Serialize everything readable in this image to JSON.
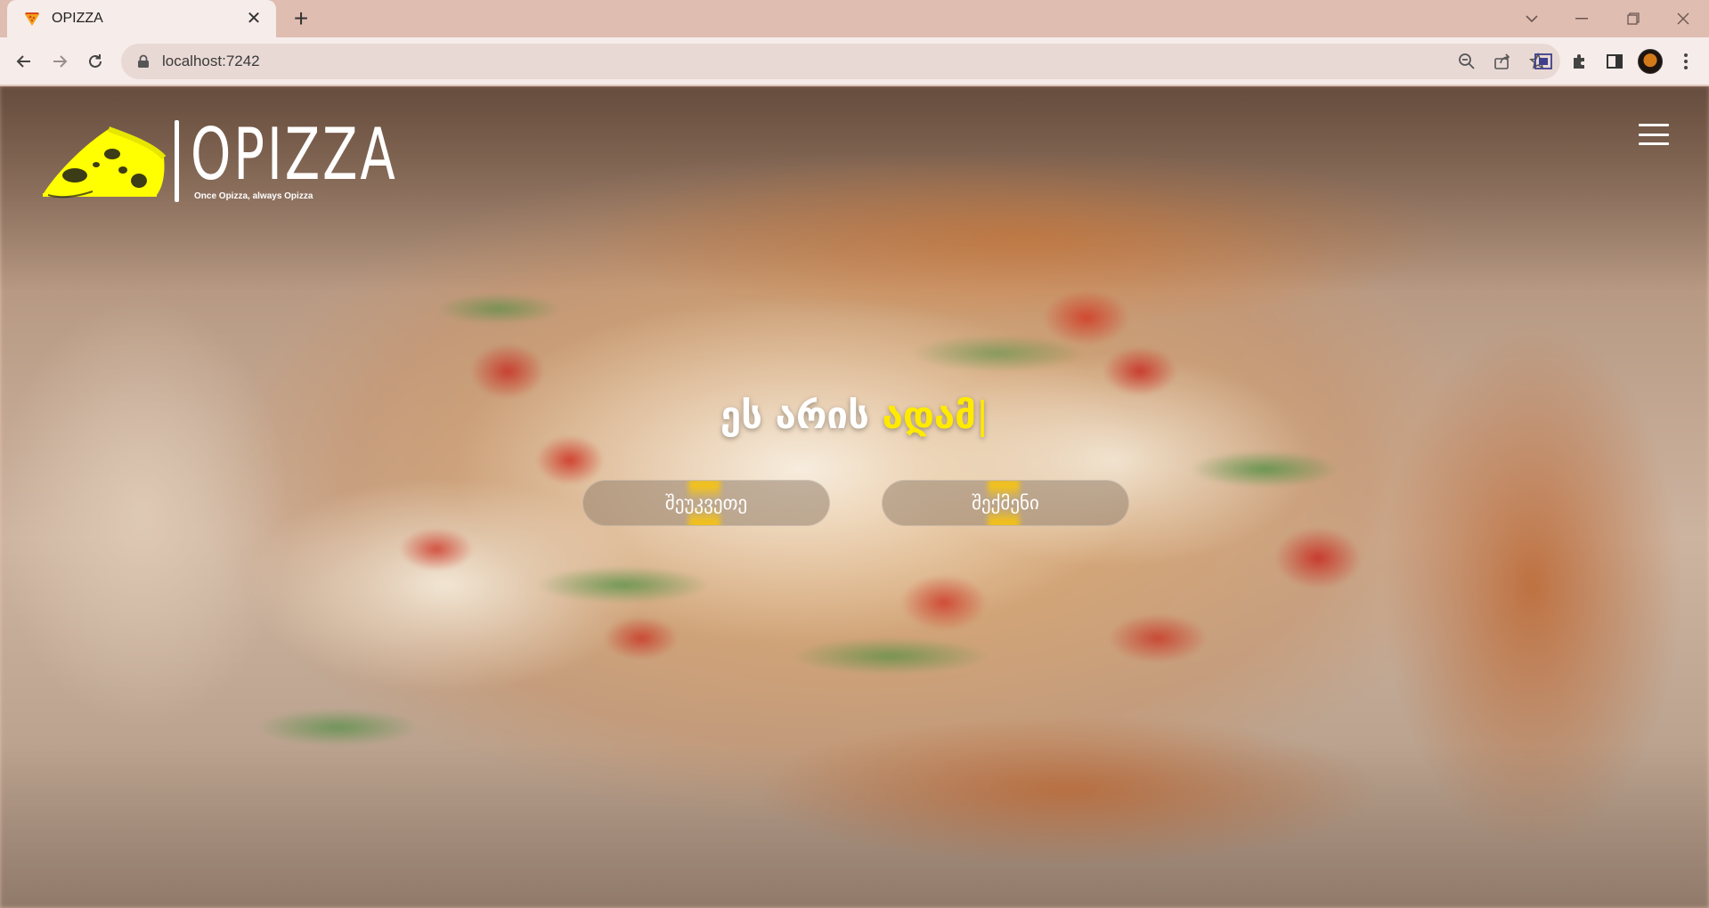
{
  "browser": {
    "tab_title": "OPIZZA",
    "new_tab_label": "+",
    "url": "localhost:7242"
  },
  "site": {
    "logo_word": "OPIZZA",
    "tagline": "Once Opizza, always Opizza",
    "brand_color": "#ffff00"
  },
  "hero": {
    "headline_main": "ეს არის ",
    "headline_highlight": "ადამ",
    "cursor": "|",
    "highlight_color": "#ffea00",
    "buttons": [
      {
        "label": "შეუკვეთე"
      },
      {
        "label": "შექმენი"
      }
    ]
  }
}
